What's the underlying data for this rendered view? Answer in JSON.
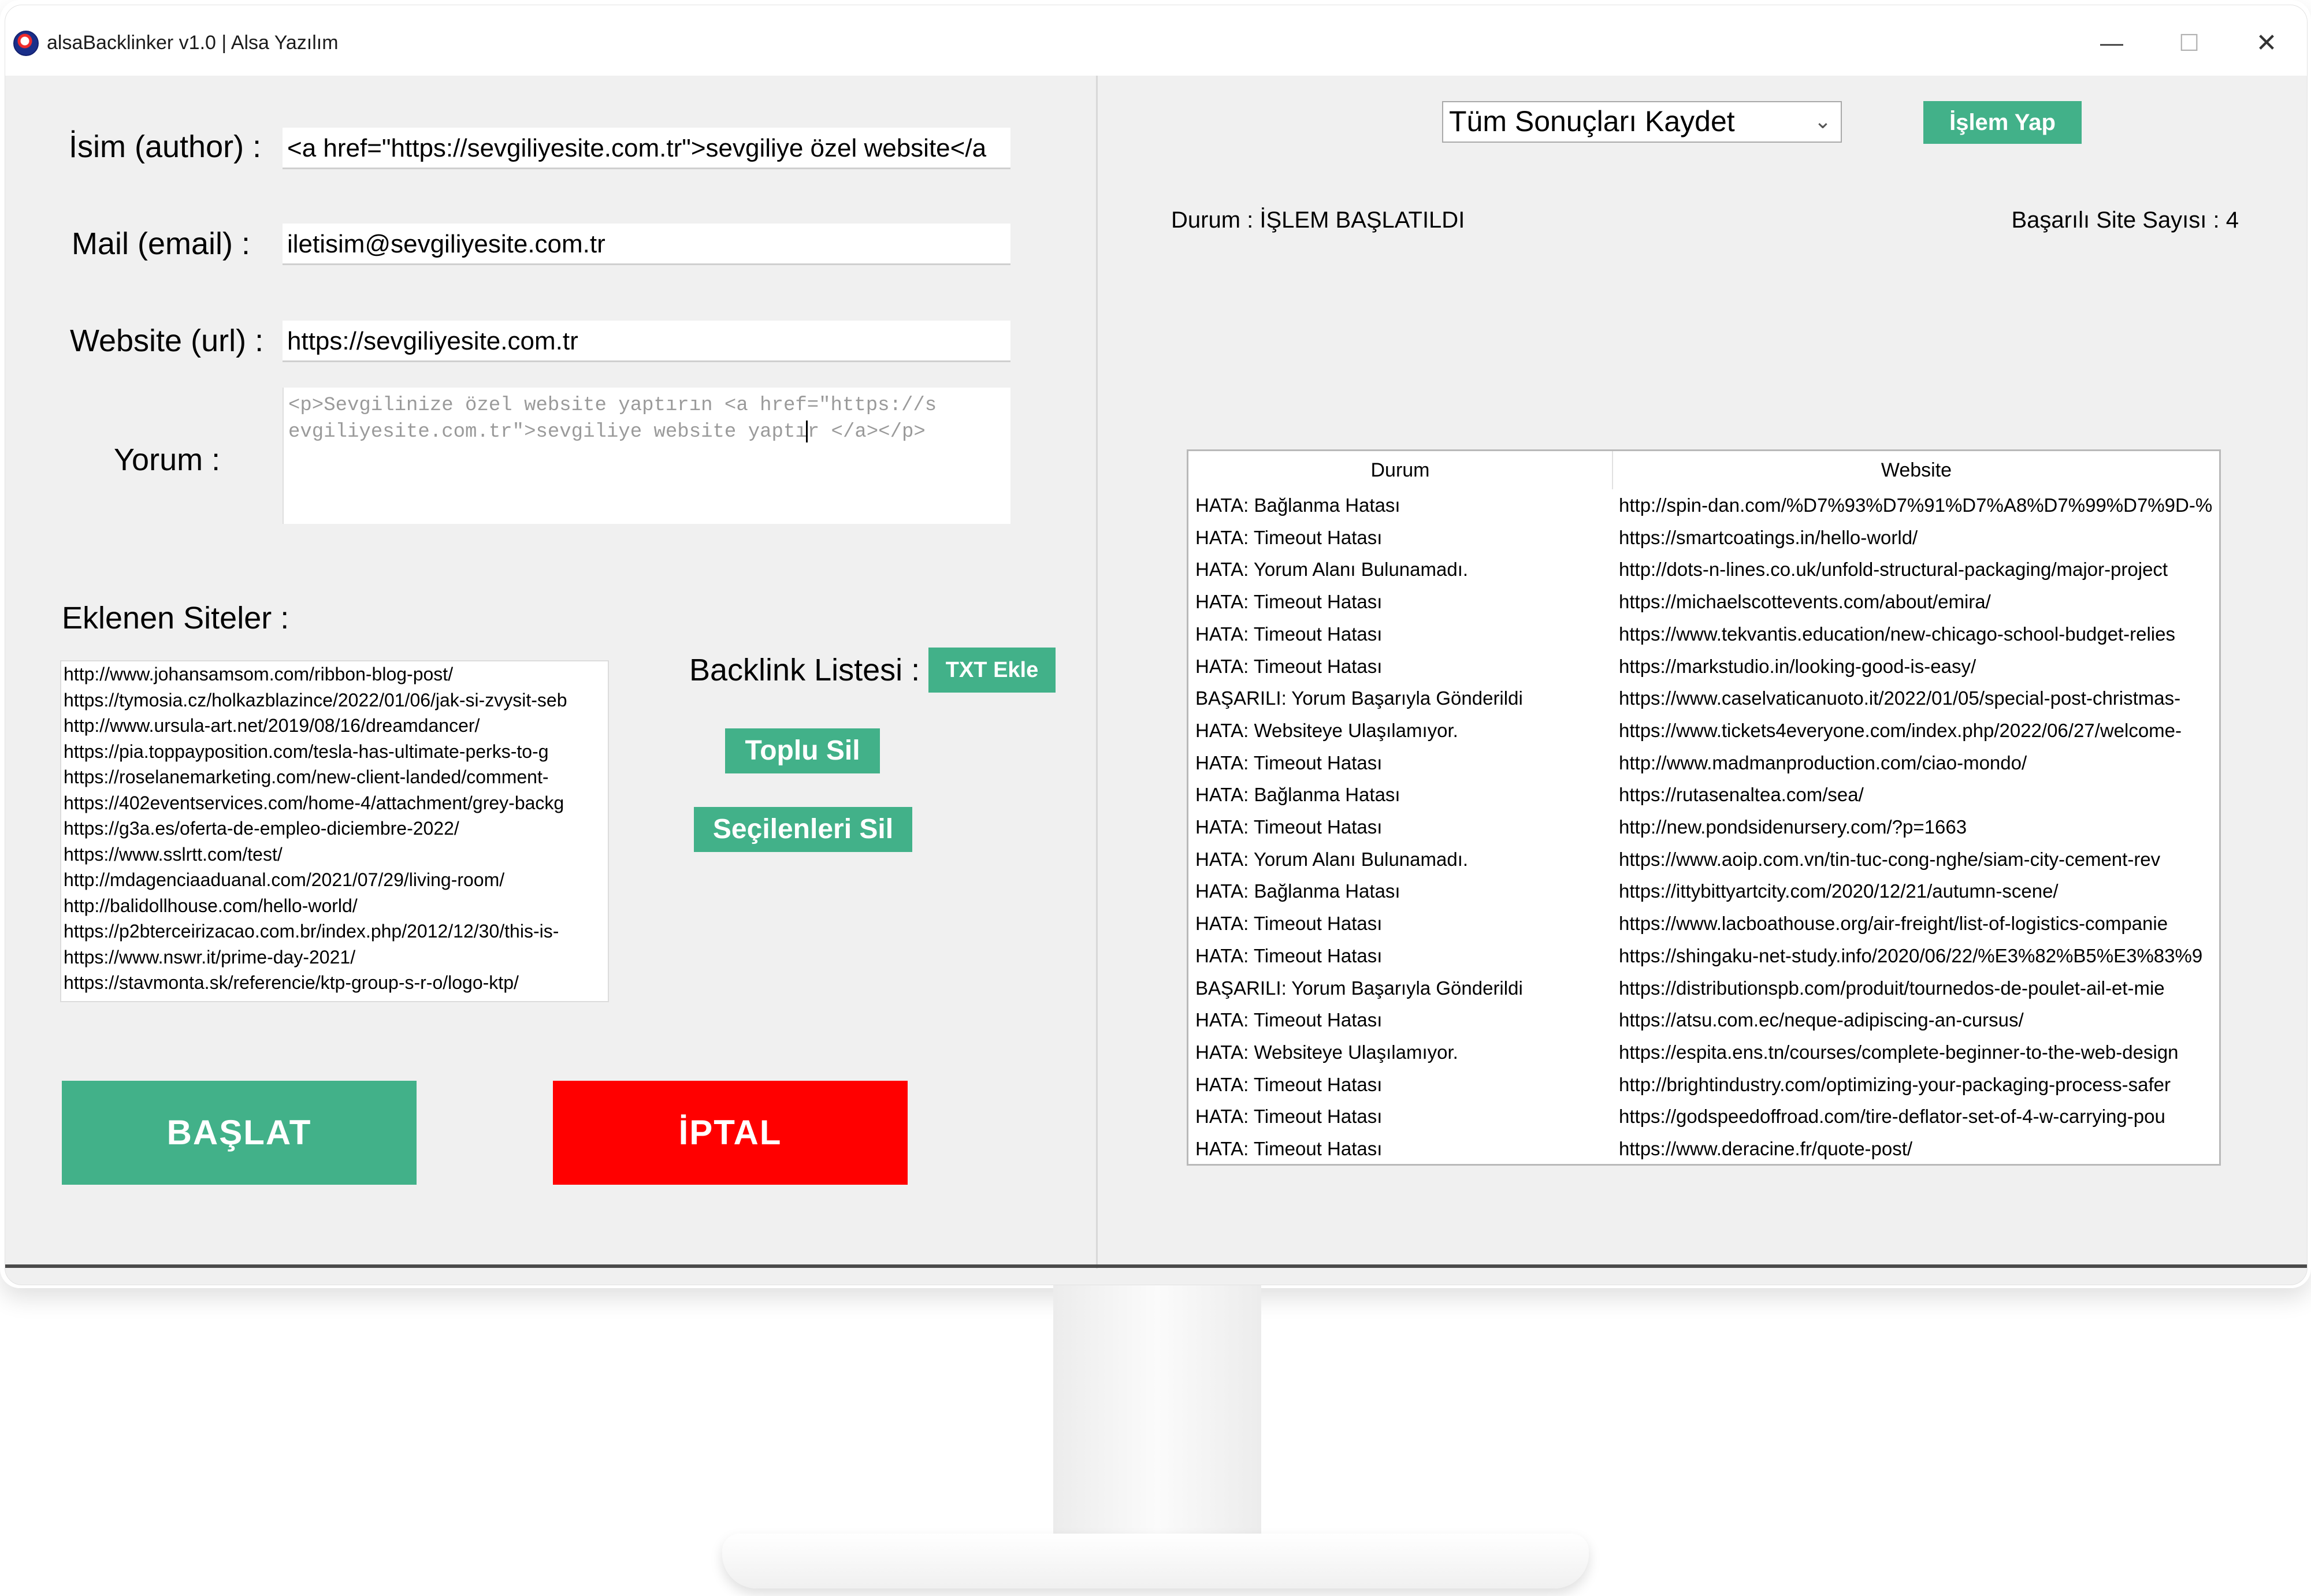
{
  "window": {
    "title": "alsaBacklinker v1.0 | Alsa Yazılım",
    "minimize": "—",
    "maximize": "☐",
    "close": "✕"
  },
  "form": {
    "author_label": "İsim (author) :",
    "author_value": "<a href=\"https://sevgiliyesite.com.tr\">sevgiliye özel website</a",
    "email_label": "Mail (email)  :",
    "email_value": "iletisim@sevgiliyesite.com.tr",
    "url_label": "Website (url) :",
    "url_value": "https://sevgiliyesite.com.tr",
    "comment_label": "Yorum :",
    "comment_line1": "<p>Sevgilinize özel website yaptırın <a href=\"https://s",
    "comment_line2a": "evgiliyesite.com.tr\">sevgiliye website yaptı",
    "comment_line2b": "r </a></p>"
  },
  "sites": {
    "label": "Eklenen Siteler :",
    "items": [
      "http://www.johansamsom.com/ribbon-blog-post/",
      "https://tymosia.cz/holkazblazince/2022/01/06/jak-si-zvysit-seb",
      "http://www.ursula-art.net/2019/08/16/dreamdancer/",
      "https://pia.toppayposition.com/tesla-has-ultimate-perks-to-g",
      "https://roselanemarketing.com/new-client-landed/comment-",
      "https://402eventservices.com/home-4/attachment/grey-backg",
      "https://g3a.es/oferta-de-empleo-diciembre-2022/",
      "https://www.sslrtt.com/test/",
      "http://mdagenciaaduanal.com/2021/07/29/living-room/",
      "http://balidollhouse.com/hello-world/",
      "https://p2bterceirizacao.com.br/index.php/2012/12/30/this-is-",
      "https://www.nswr.it/prime-day-2021/",
      "https://stavmonta.sk/referencie/ktp-group-s-r-o/logo-ktp/"
    ]
  },
  "backlink": {
    "label": "Backlink Listesi :",
    "txt_button": "TXT Ekle",
    "bulk_delete": "Toplu Sil",
    "delete_selected": "Seçilenleri Sil"
  },
  "actions": {
    "start": "BAŞLAT",
    "cancel": "İPTAL"
  },
  "right": {
    "combo_value": "Tüm Sonuçları Kaydet",
    "process_button": "İşlem Yap",
    "status": "Durum : İŞLEM BAŞLATILDI",
    "success_count": "Başarılı Site Sayısı : 4"
  },
  "table": {
    "columns": [
      "Durum",
      "Website"
    ],
    "rows": [
      [
        "HATA: Bağlanma Hatası",
        "http://spin-dan.com/%D7%93%D7%91%D7%A8%D7%99%D7%9D-%"
      ],
      [
        "HATA: Timeout Hatası",
        "https://smartcoatings.in/hello-world/"
      ],
      [
        "HATA: Yorum Alanı Bulunamadı.",
        "http://dots-n-lines.co.uk/unfold-structural-packaging/major-project"
      ],
      [
        "HATA: Timeout Hatası",
        "https://michaelscottevents.com/about/emira/"
      ],
      [
        "HATA: Timeout Hatası",
        "https://www.tekvantis.education/new-chicago-school-budget-relies"
      ],
      [
        "HATA: Timeout Hatası",
        "https://markstudio.in/looking-good-is-easy/"
      ],
      [
        "BAŞARILI: Yorum Başarıyla Gönderildi",
        "https://www.caselvaticanuoto.it/2022/01/05/special-post-christmas-"
      ],
      [
        "HATA: Websiteye Ulaşılamıyor.",
        "https://www.tickets4everyone.com/index.php/2022/06/27/welcome-"
      ],
      [
        "HATA: Timeout Hatası",
        "http://www.madmanproduction.com/ciao-mondo/"
      ],
      [
        "HATA: Bağlanma Hatası",
        "https://rutasenaltea.com/sea/"
      ],
      [
        "HATA: Timeout Hatası",
        "http://new.pondsidenursery.com/?p=1663"
      ],
      [
        "HATA: Yorum Alanı Bulunamadı.",
        "https://www.aoip.com.vn/tin-tuc-cong-nghe/siam-city-cement-rev"
      ],
      [
        "HATA: Bağlanma Hatası",
        "https://ittybittyartcity.com/2020/12/21/autumn-scene/"
      ],
      [
        "HATA: Timeout Hatası",
        "https://www.lacboathouse.org/air-freight/list-of-logistics-companie"
      ],
      [
        "HATA: Timeout Hatası",
        "https://shingaku-net-study.info/2020/06/22/%E3%82%B5%E3%83%9"
      ],
      [
        "BAŞARILI: Yorum Başarıyla Gönderildi",
        "https://distributionspb.com/produit/tournedos-de-poulet-ail-et-mie"
      ],
      [
        "HATA: Timeout Hatası",
        "https://atsu.com.ec/neque-adipiscing-an-cursus/"
      ],
      [
        "HATA: Websiteye Ulaşılamıyor.",
        "https://espita.ens.tn/courses/complete-beginner-to-the-web-design"
      ],
      [
        "HATA: Timeout Hatası",
        "http://brightindustry.com/optimizing-your-packaging-process-safer"
      ],
      [
        "HATA: Timeout Hatası",
        "https://godspeedoffroad.com/tire-deflator-set-of-4-w-carrying-pou"
      ],
      [
        "HATA: Timeout Hatası",
        "https://www.deracine.fr/quote-post/"
      ]
    ]
  },
  "colors": {
    "accent_green": "#42b189",
    "cancel_red": "#ff0000",
    "panel_bg": "#f0f0f0"
  }
}
